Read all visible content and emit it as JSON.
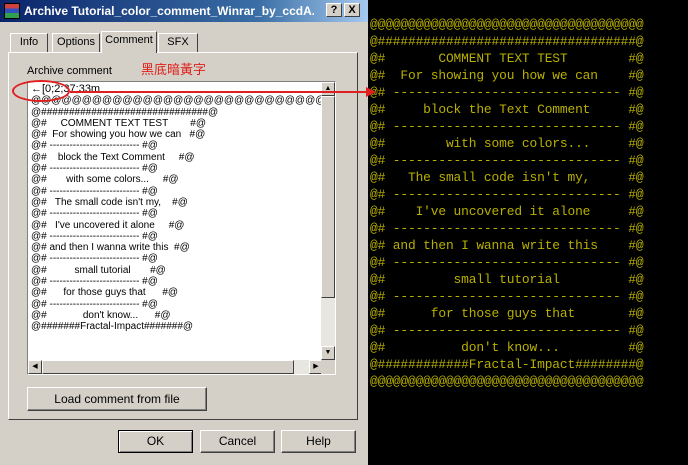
{
  "window": {
    "title": "Archive Tutorial_color_comment_Winrar_by_ccdA...",
    "help_glyph": "?",
    "close_glyph": "X"
  },
  "tabs": [
    {
      "label": "Info",
      "active": false
    },
    {
      "label": "Options",
      "active": false
    },
    {
      "label": "Comment",
      "active": true
    },
    {
      "label": "SFX",
      "active": false
    }
  ],
  "comment_panel": {
    "label": "Archive comment",
    "annotation_chinese": "黑底暗黃字",
    "comment_lines": [
      "←[0;2;37;33m",
      "@@@@@@@@@@@@@@@@@@@@@@@@@@@@@",
      "@##############################@",
      "@#     COMMENT TEXT TEST        #@",
      "@#  For showing you how we can   #@",
      "@# --------------------------- #@",
      "@#    block the Text Comment     #@",
      "@# --------------------------- #@",
      "@#       with some colors...     #@",
      "@# --------------------------- #@",
      "@#   The small code isn't my,    #@",
      "@# --------------------------- #@",
      "@#   I've uncovered it alone     #@",
      "@# --------------------------- #@",
      "@# and then I wanna write this  #@",
      "@# --------------------------- #@",
      "@#          small tutorial       #@",
      "@# --------------------------- #@",
      "@#      for those guys that      #@",
      "@# --------------------------- #@",
      "@#             don't know...      #@",
      "@#######Fractal-Impact#######@"
    ],
    "load_button": "Load comment from file"
  },
  "buttons": {
    "ok": "OK",
    "cancel": "Cancel",
    "help": "Help"
  },
  "terminal": {
    "colors": {
      "background": "#000000",
      "foreground": "#b8b000",
      "annotation": "#e02020"
    },
    "lines": [
      "@@@@@@@@@@@@@@@@@@@@@@@@@@@@@@@@@@@@",
      "@##################################@",
      "@#       COMMENT TEXT TEST        #@",
      "@#  For showing you how we can    #@",
      "@# ------------------------------ #@",
      "@#     block the Text Comment     #@",
      "@# ------------------------------ #@",
      "@#        with some colors...     #@",
      "@# ------------------------------ #@",
      "@#   The small code isn't my,     #@",
      "@# ------------------------------ #@",
      "@#    I've uncovered it alone     #@",
      "@# ------------------------------ #@",
      "@# and then I wanna write this    #@",
      "@# ------------------------------ #@",
      "@#         small tutorial         #@",
      "@# ------------------------------ #@",
      "@#      for those guys that       #@",
      "@# ------------------------------ #@",
      "@#          don't know...         #@",
      "@############Fractal-Impact########@",
      "@@@@@@@@@@@@@@@@@@@@@@@@@@@@@@@@@@@@"
    ]
  }
}
